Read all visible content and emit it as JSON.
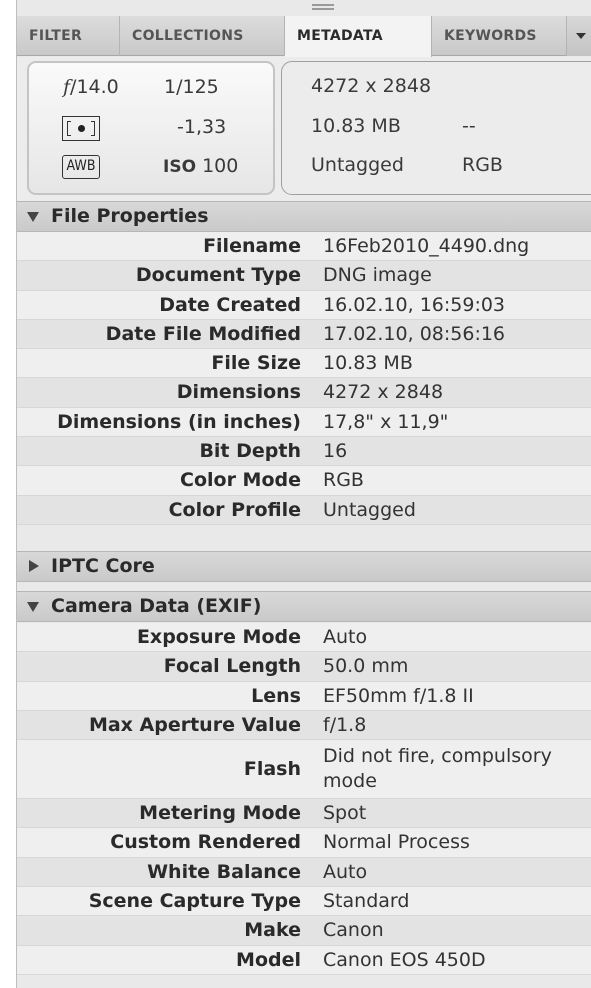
{
  "tabs": [
    {
      "label": "FILTER"
    },
    {
      "label": "COLLECTIONS"
    },
    {
      "label": "METADATA"
    },
    {
      "label": "KEYWORDS"
    }
  ],
  "camera_info": {
    "aperture_value": "14.0",
    "shutter": "1/125",
    "exposure_comp": "-1,33",
    "white_balance_icon": "AWB",
    "iso_label": "ISO",
    "iso_value": "100",
    "dimensions": "4272 x 2848",
    "file_size": "10.83 MB",
    "placeholder": "--",
    "profile": "Untagged",
    "color_mode": "RGB"
  },
  "sections": {
    "file_properties": "File Properties",
    "iptc_core": "IPTC Core",
    "camera_data": "Camera Data (EXIF)"
  },
  "file_properties": [
    {
      "key": "Filename",
      "value": "16Feb2010_4490.dng"
    },
    {
      "key": "Document Type",
      "value": "DNG image"
    },
    {
      "key": "Date Created",
      "value": "16.02.10, 16:59:03"
    },
    {
      "key": "Date File Modified",
      "value": "17.02.10, 08:56:16"
    },
    {
      "key": "File Size",
      "value": "10.83 MB"
    },
    {
      "key": "Dimensions",
      "value": "4272 x 2848"
    },
    {
      "key": "Dimensions (in inches)",
      "value": "17,8\" x 11,9\""
    },
    {
      "key": "Bit Depth",
      "value": "16"
    },
    {
      "key": "Color Mode",
      "value": "RGB"
    },
    {
      "key": "Color Profile",
      "value": "Untagged"
    }
  ],
  "camera_data": [
    {
      "key": "Exposure Mode",
      "value": "Auto"
    },
    {
      "key": "Focal Length",
      "value": "50.0 mm"
    },
    {
      "key": "Lens",
      "value": "EF50mm f/1.8 II"
    },
    {
      "key": "Max Aperture Value",
      "value": "f/1.8"
    },
    {
      "key": "Flash",
      "value": "Did not fire, compulsory mode"
    },
    {
      "key": "Metering Mode",
      "value": "Spot"
    },
    {
      "key": "Custom Rendered",
      "value": "Normal Process"
    },
    {
      "key": "White Balance",
      "value": "Auto"
    },
    {
      "key": "Scene Capture Type",
      "value": "Standard"
    },
    {
      "key": "Make",
      "value": "Canon"
    },
    {
      "key": "Model",
      "value": "Canon EOS 450D"
    }
  ]
}
